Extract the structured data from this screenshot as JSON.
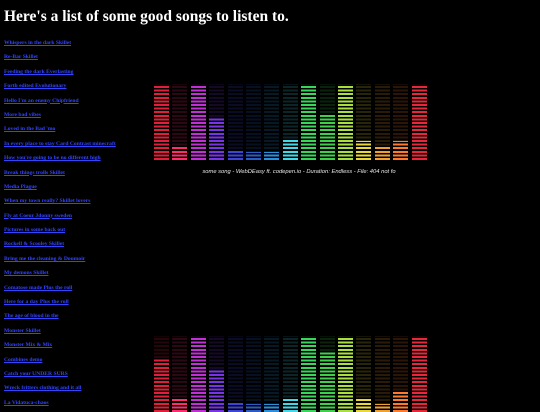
{
  "page": {
    "title": "Here's a list of some good songs to listen to."
  },
  "songs": [
    "Whispers in the dark Skillet",
    "Re-Bar Skillet",
    "Feeding the dark Everlasting",
    "Forth edited Evolutionary",
    "Hello I'm an enemy Chipfriend",
    "More bad vibes",
    "Loved in the Bad 'mo",
    "In every place to stay Card Contrast minecraft",
    "How you're going to be no different high",
    "Break things trolls Skillet",
    "Media Plague",
    "When my town really? Skillet lovers",
    "Fly at Coeur Jdonny sweden",
    "Pictures in some back out",
    "Rockell & Scooley Skillet",
    "Bring me the cleaning & Doumoir",
    "My demons Skillet",
    "Comatose made Plus the roll",
    "Here for a day Plus the roll",
    "The age of blood in the",
    "Monster Skillet",
    "Monster Mix & Mix",
    "Combines demo",
    "Catch your UNDER SURS",
    "Wreck fritters clothing and it all",
    "La Vidatuca-chaos"
  ],
  "visualizer": {
    "caption": "some song - WebDEasy ft. codepen.io - Duration: Endless - File: 404 not fo",
    "bar_colors": [
      "#e0203a",
      "#ff2d6e",
      "#c22fd6",
      "#7a34e8",
      "#3d44d8",
      "#2a5cc4",
      "#2a8fdc",
      "#43d8e8",
      "#38d65a",
      "#3fcf4a",
      "#a8e040",
      "#e8d83a",
      "#f0a030",
      "#ff7a2a",
      "#e8283a"
    ],
    "bar_levels_top": [
      0.97,
      0.19,
      0.97,
      0.55,
      0.15,
      0.1,
      0.1,
      0.28,
      0.97,
      0.6,
      0.97,
      0.25,
      0.19,
      0.25,
      0.97
    ],
    "bar_levels_bottom": [
      0.7,
      0.19,
      0.97,
      0.55,
      0.15,
      0.1,
      0.1,
      0.19,
      0.97,
      0.8,
      0.97,
      0.19,
      0.1,
      0.28,
      0.97
    ]
  }
}
